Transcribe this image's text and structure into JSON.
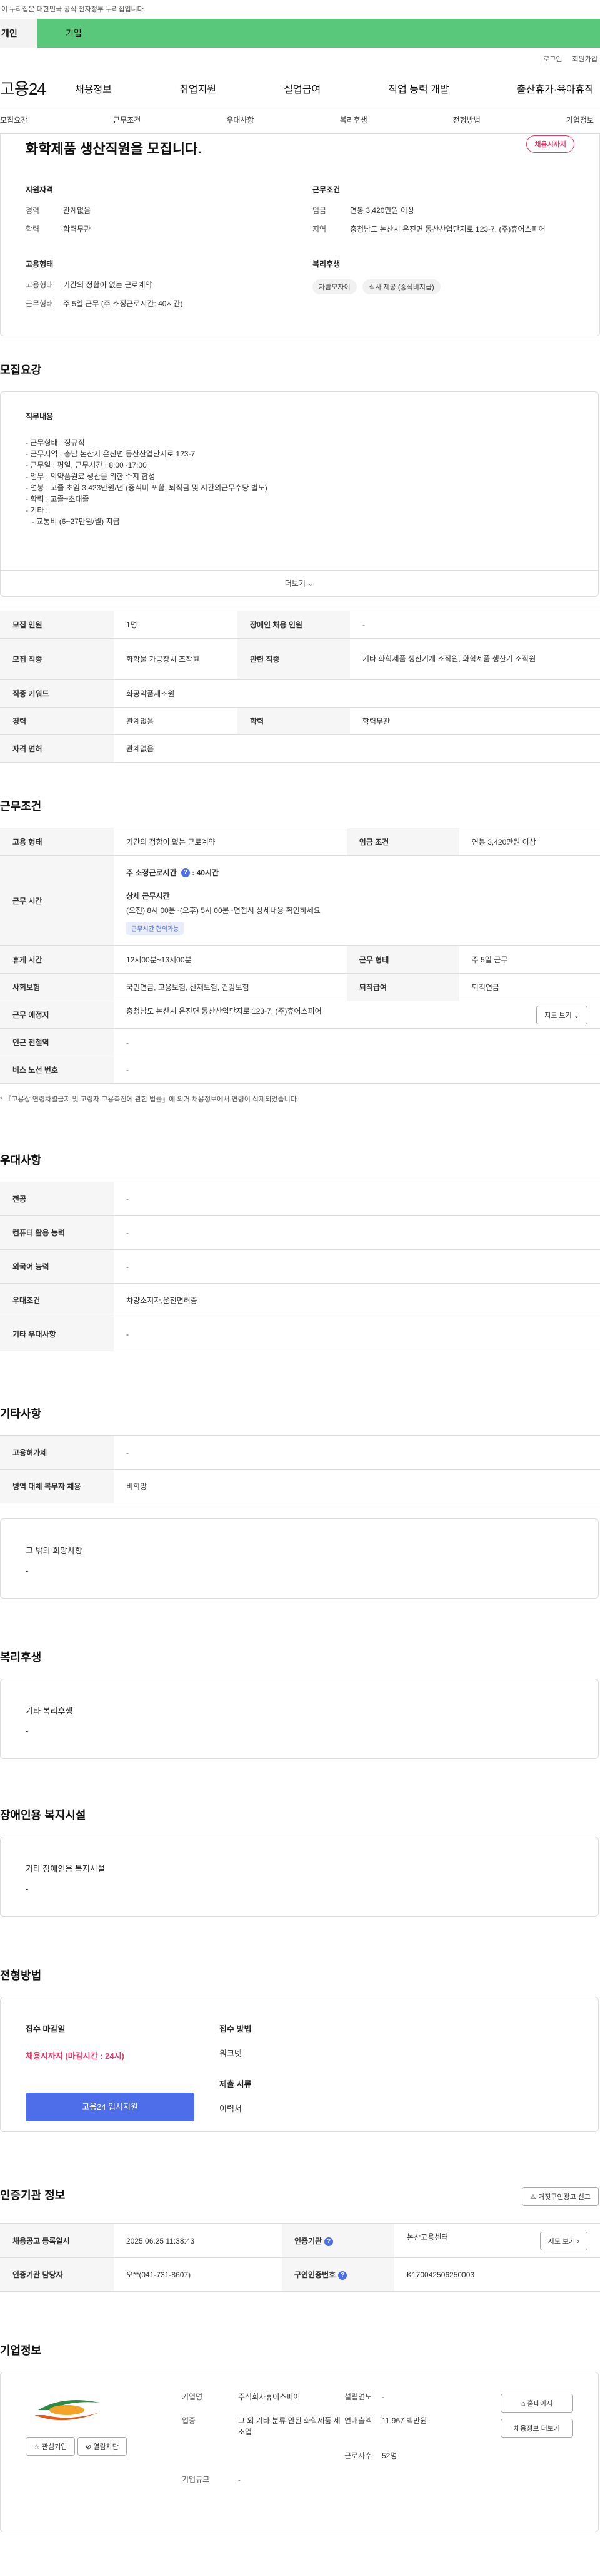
{
  "gov_banner": "이 누리집은 대한민국 공식 전자정부 누리집입니다.",
  "top_tabs": [
    "개인",
    "기업"
  ],
  "util": [
    "로그인",
    "회원가입"
  ],
  "logo": "고용24",
  "gnb": [
    "채용정보",
    "취업지원",
    "실업급여",
    "직업 능력 개발",
    "출산휴가·육아휴직"
  ],
  "subnav": [
    "모집요강",
    "근무조건",
    "우대사항",
    "복리후생",
    "전형방법",
    "기업정보"
  ],
  "summary": {
    "title": "화학제품 생산직원을 모집니다.",
    "badge": "채용시까지",
    "qual_label": "지원자격",
    "exp_k": "경력",
    "exp_v": "관계없음",
    "edu_k": "학력",
    "edu_v": "학력무관",
    "cond_label": "근무조건",
    "wage_k": "임금",
    "wage_v": "연봉 3,420만원 이상",
    "area_k": "지역",
    "area_v": "충청남도 논산시 은진면 동산산업단지로 123-7, (주)휴어스피어",
    "emp_label": "고용형태",
    "type_k": "고용형태",
    "type_v": "기간의 정함이 없는 근로계약",
    "hours_k": "근무형태",
    "hours_v": "주 5일 근무 (주 소정근로시간: 40시간)",
    "welfare_label": "복리후생",
    "chips": [
      "자람모자이",
      "식사 제공 (중식비지급)"
    ]
  },
  "recruit": {
    "section": "모집요강",
    "job_label": "직무내용",
    "lines": [
      "- 근무형태 : 정규직",
      "- 근무지역 : 충남 논산시 은진면 동산산업단지로 123-7",
      "- 근무일 : 평일, 근무시간 : 8:00~17:00",
      "- 업무 : 의약품원료 생산을 위한 수지 합성",
      "- 연봉 : 고졸 초임 3,423만원/년 (중식비 포함, 퇴직금 및 시간외근무수당 별도)",
      "- 학력 : 고졸~초대졸",
      "- 기타 :",
      "   - 교통비 (6~27만원/월) 지급"
    ],
    "more": "더보기",
    "rows": [
      {
        "k": "모집 인원",
        "v": "1명",
        "k2": "장애인 채용 인원",
        "v2": "-"
      },
      {
        "k": "모집 직종",
        "v": "화학물 가공장치 조작원",
        "k2": "관련 직종",
        "v2": "기타 화학제품 생산기계 조작원, 화학제품 생산기 조작원"
      },
      {
        "k": "직종 키워드",
        "v": "화공약품제조원"
      },
      {
        "k": "경력",
        "v": "관계없음",
        "k2": "학력",
        "v2": "학력무관"
      },
      {
        "k": "자격 면허",
        "v": "관계없음"
      }
    ]
  },
  "work": {
    "section": "근무조건",
    "type_k": "고용 형태",
    "type_v": "기간의 정함이 없는 근로계약",
    "wage_k": "임금 조건",
    "wage_v": "연봉 3,420만원 이상",
    "hours_k": "근무 시간",
    "weekly": "주 소정근로시간",
    "weekly_v": "40시간",
    "detail_label": "상세 근무시간",
    "detail_v": "(오전) 8시 00분~(오후) 5시 00분~면접시 상세내용 확인하세요",
    "flex_tag": "근무시간 협의가능",
    "rest_k": "휴게 시간",
    "rest_v": "12시00분~13시00분",
    "form_k": "근무 형태",
    "form_v": "주 5일 근무",
    "ins_k": "사회보험",
    "ins_v": "국민연금, 고용보험, 산재보험, 건강보험",
    "sev_k": "퇴직급여",
    "sev_v": "퇴직연금",
    "place_k": "근무 예정지",
    "place_v": "충청남도 논산시 은진면 동산산업단지로 123-7, (주)휴어스피어",
    "map_btn": "지도 보기",
    "sub_k": "인근 전철역",
    "sub_v": "-",
    "bus_k": "버스 노선 번호",
    "bus_v": "-",
    "note": "* 『고용상 연령차별금지 및 고령자 고용촉진에 관한 법률』에 의거 채용정보에서 연령이 삭제되었습니다."
  },
  "pref": {
    "section": "우대사항",
    "rows": [
      {
        "k": "전공",
        "v": "-"
      },
      {
        "k": "컴퓨터 활용 능력",
        "v": "-"
      },
      {
        "k": "외국어 능력",
        "v": "-"
      },
      {
        "k": "우대조건",
        "v": "차량소지자,운전면허증"
      },
      {
        "k": "기타 우대사항",
        "v": "-"
      }
    ]
  },
  "etc": {
    "section": "기타사항",
    "rows": [
      {
        "k": "고용허가제",
        "v": "-"
      },
      {
        "k": "병역 대체 복무자 채용",
        "v": "비희망"
      }
    ],
    "other_label": "그 밖의 희망사항",
    "other_v": "-"
  },
  "welfare": {
    "section": "복리후생",
    "label": "기타 복리후생",
    "v": "-"
  },
  "disabled": {
    "section": "장애인용 복지시설",
    "label": "기타 장애인용 복지시설",
    "v": "-"
  },
  "selection": {
    "section": "전형방법",
    "deadline_label": "접수 마감일",
    "deadline_v": "채용시까지 (마감시간 : 24시)",
    "apply_btn": "고용24 입사지원",
    "method_label": "접수 방법",
    "method_v": "워크넷",
    "docs_label": "제출 서류",
    "docs_v": "이력서"
  },
  "agency": {
    "section": "인증기관 정보",
    "report_btn": "거짓구인광고 신고",
    "reg_k": "채용공고 등록일시",
    "reg_v": "2025.06.25 11:38:43",
    "inst_k": "인증기관",
    "inst_v": "논산고용센터",
    "map_btn": "지도 보기",
    "mgr_k": "인증기관 담당자",
    "mgr_v": "오**(041-731-8607)",
    "no_k": "구인인증번호",
    "no_v": "K170042506250003"
  },
  "company": {
    "section": "기업정보",
    "fav_btn": "관심기업",
    "block_btn": "열람차단",
    "name_k": "기업명",
    "name_v": "주식회사휴어스피어",
    "found_k": "설립연도",
    "found_v": "-",
    "biz_k": "업종",
    "biz_v": "그 외 기타 분류 안된 화학제품 제조업",
    "sales_k": "연매출액",
    "sales_v": "11,967 백만원",
    "emp_k": "근로자수",
    "emp_v": "52명",
    "size_k": "기업규모",
    "size_v": "-",
    "home_btn": "홈페이지",
    "jobs_btn": "채용정보 더보기"
  }
}
